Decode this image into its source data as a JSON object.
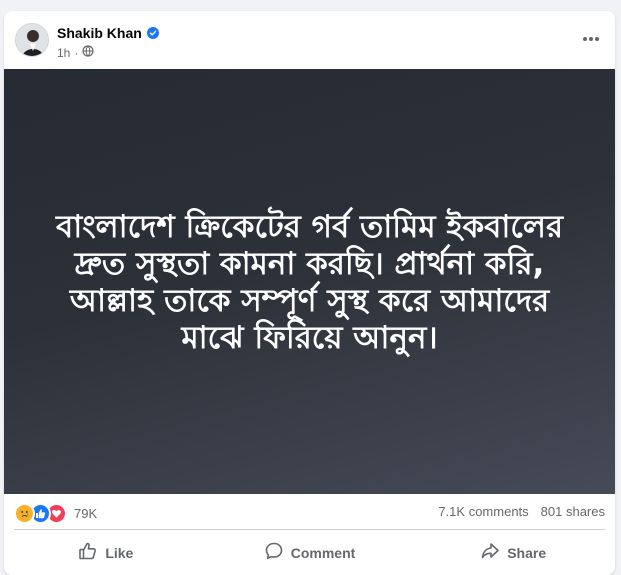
{
  "post": {
    "author": "Shakib Khan",
    "time": "1h",
    "text": "বাংলাদেশ ক্রিকেটের গর্ব তামিম ইকবালের দ্রুত সুস্থতা কামনা করছি। প্রার্থনা করি, আল্লাহ তাকে সম্পূর্ণ সুস্থ করে আমাদের মাঝে ফিরিয়ে আনুন।"
  },
  "stats": {
    "reaction_icons": [
      "sad-icon",
      "like-icon",
      "love-icon"
    ],
    "reactions": "79K",
    "comments": "7.1K comments",
    "shares": "801 shares"
  },
  "actions": {
    "like": "Like",
    "comment": "Comment",
    "share": "Share"
  },
  "colors": {
    "verified": "#1877f2",
    "like": "#1877f2",
    "love": "#f33e58",
    "sad": "#f7b125"
  }
}
